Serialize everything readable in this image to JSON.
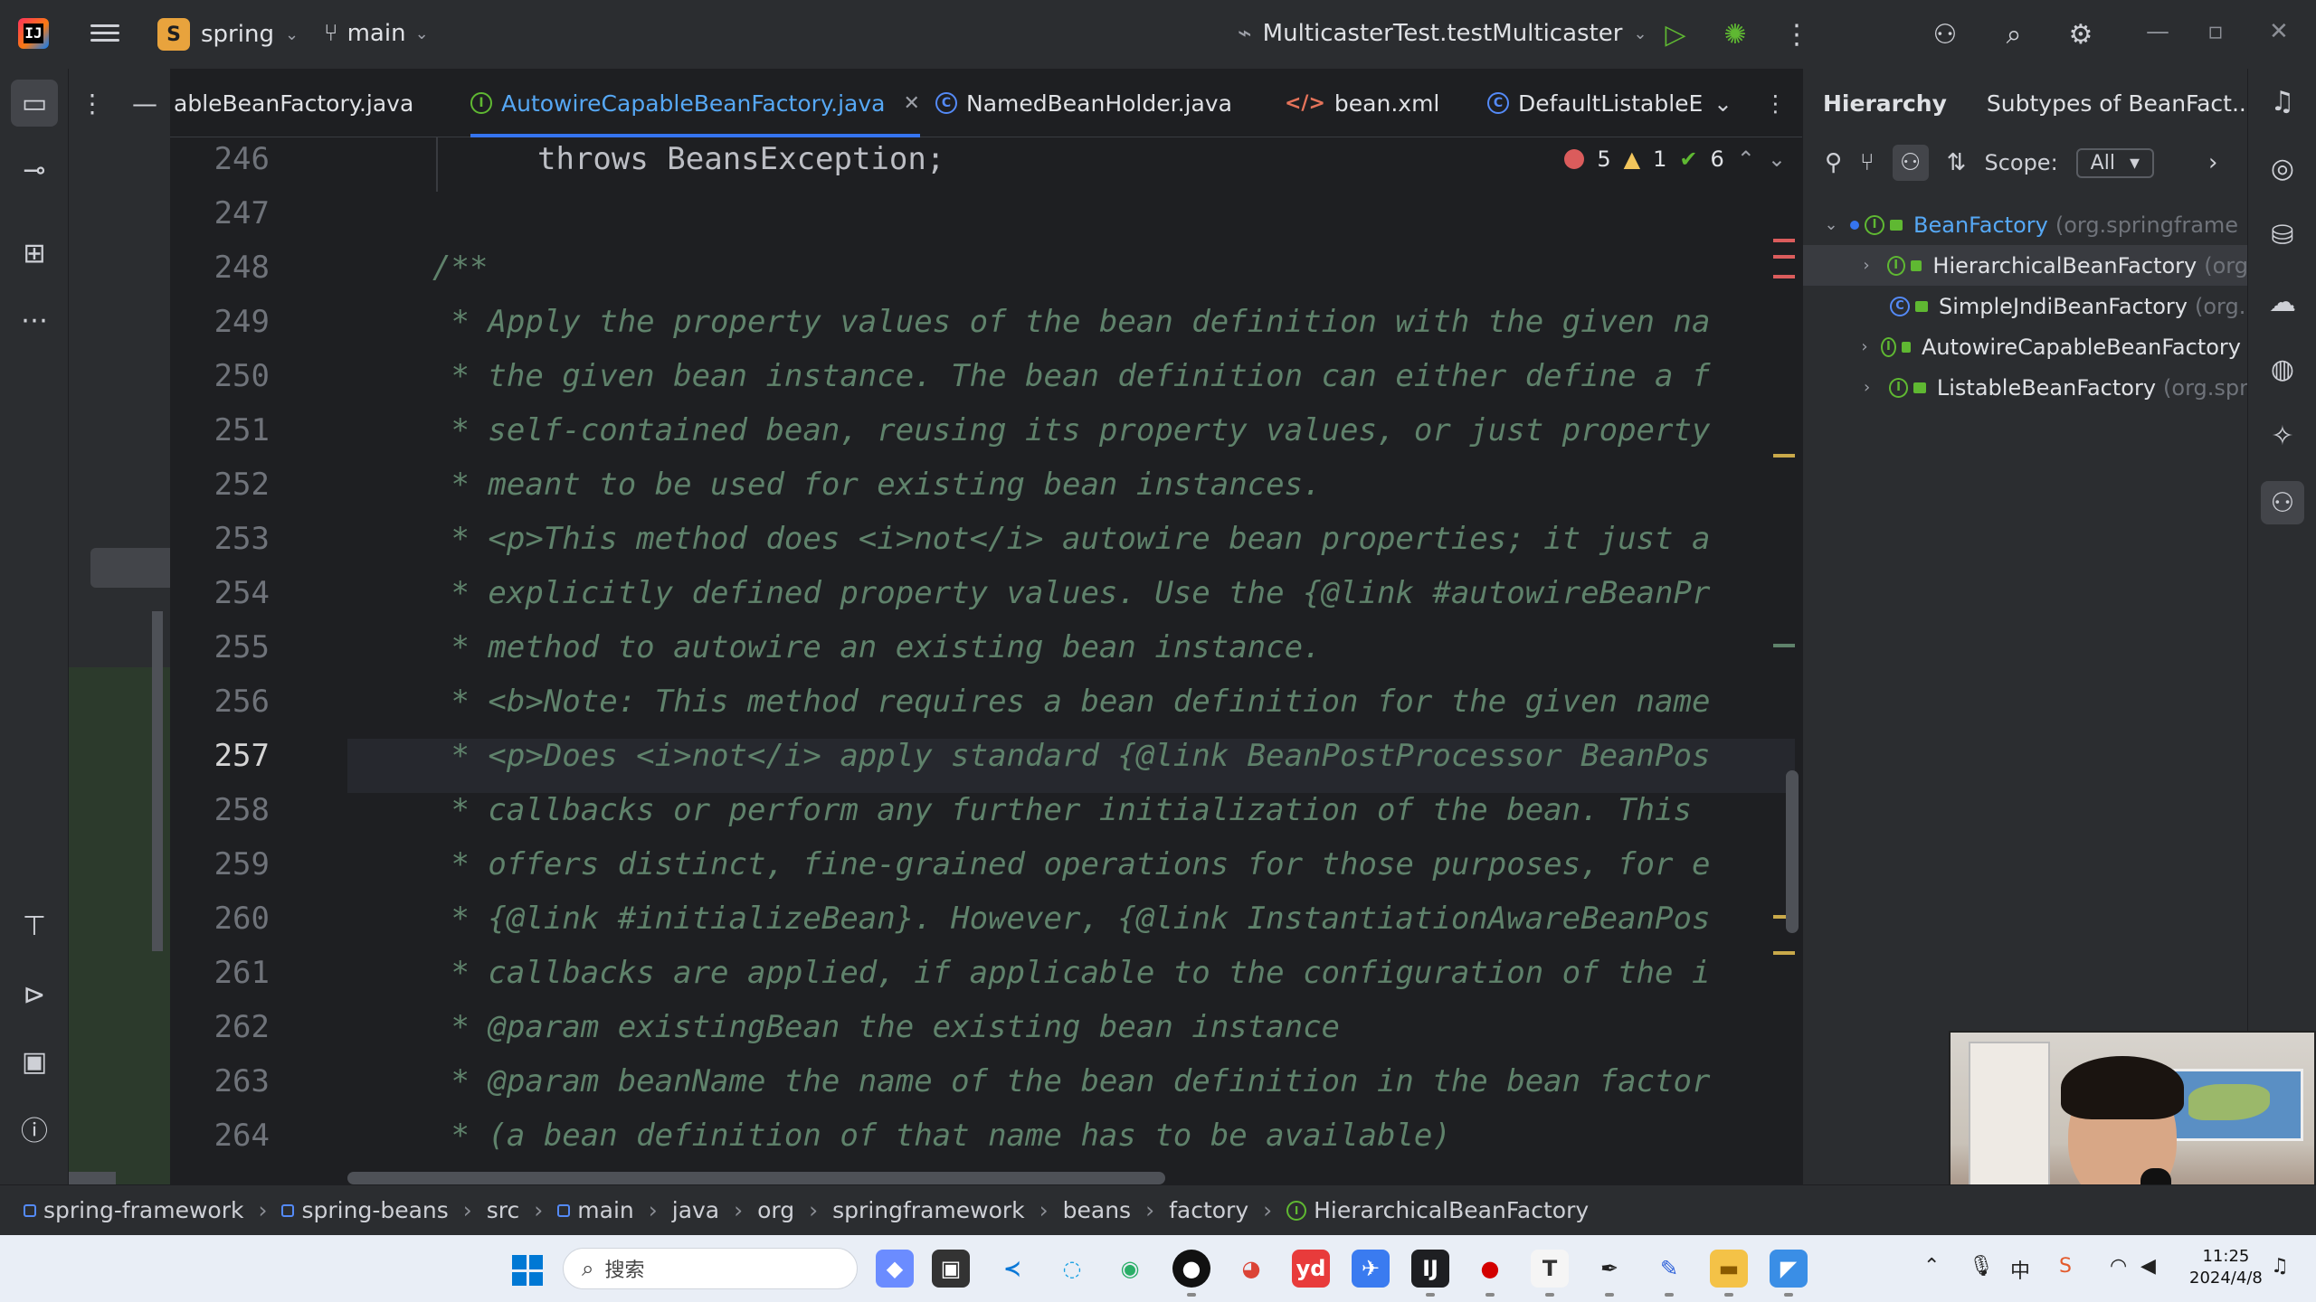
{
  "titlebar": {
    "project_badge": "S",
    "project_name": "spring",
    "branch": "main",
    "run_config": "MulticasterTest.testMulticaster"
  },
  "tabs": [
    {
      "label": "ableBeanFactory.java",
      "kind": "none",
      "active": false
    },
    {
      "label": "AutowireCapableBeanFactory.java",
      "kind": "interface",
      "active": true
    },
    {
      "label": "NamedBeanHolder.java",
      "kind": "class",
      "active": false
    },
    {
      "label": "bean.xml",
      "kind": "xml",
      "active": false
    },
    {
      "label": "DefaultListableE",
      "kind": "class",
      "active": false
    }
  ],
  "inspections": {
    "errors": "5",
    "warnings": "1",
    "weak_warnings": "6"
  },
  "editor": {
    "current_line": "257",
    "lines": [
      {
        "n": "246",
        "text": "throws BeansException;"
      },
      {
        "n": "247",
        "text": ""
      },
      {
        "n": "248",
        "text": "/**"
      },
      {
        "n": "249",
        "text": " * Apply the property values of the bean definition with the given na"
      },
      {
        "n": "250",
        "text": " * the given bean instance. The bean definition can either define a f"
      },
      {
        "n": "251",
        "text": " * self-contained bean, reusing its property values, or just property"
      },
      {
        "n": "252",
        "text": " * meant to be used for existing bean instances."
      },
      {
        "n": "253",
        "text": " * <p>This method does <i>not</i> autowire bean properties; it just a"
      },
      {
        "n": "254",
        "text": " * explicitly defined property values. Use the {@link #autowireBeanPr"
      },
      {
        "n": "255",
        "text": " * method to autowire an existing bean instance."
      },
      {
        "n": "256",
        "text": " * <b>Note: This method requires a bean definition for the given name"
      },
      {
        "n": "257",
        "text": " * <p>Does <i>not</i> apply standard {@link BeanPostProcessor BeanPos"
      },
      {
        "n": "258",
        "text": " * callbacks or perform any further initialization of the bean. This"
      },
      {
        "n": "259",
        "text": " * offers distinct, fine-grained operations for those purposes, for e"
      },
      {
        "n": "260",
        "text": " * {@link #initializeBean}. However, {@link InstantiationAwareBeanPos"
      },
      {
        "n": "261",
        "text": " * callbacks are applied, if applicable to the configuration of the i"
      },
      {
        "n": "262",
        "text": " * @param existingBean the existing bean instance"
      },
      {
        "n": "263",
        "text": " * @param beanName the name of the bean definition in the bean factor"
      },
      {
        "n": "264",
        "text": " * (a bean definition of that name has to be available)"
      }
    ]
  },
  "hierarchy": {
    "tab_hierarchy": "Hierarchy",
    "tab_subtypes": "Subtypes of BeanFact...",
    "scope_label": "Scope:",
    "scope_value": "All",
    "nodes": [
      {
        "name": "BeanFactory",
        "pkg": "(org.springframe",
        "kind": "interface",
        "level": 0,
        "expanded": true
      },
      {
        "name": "HierarchicalBeanFactory",
        "pkg": "(org",
        "kind": "interface",
        "level": 1,
        "expanded": false
      },
      {
        "name": "SimpleJndiBeanFactory",
        "pkg": "(org.",
        "kind": "class",
        "level": 1,
        "expanded": null
      },
      {
        "name": "AutowireCapableBeanFactory",
        "pkg": "",
        "kind": "interface",
        "level": 1,
        "expanded": false
      },
      {
        "name": "ListableBeanFactory",
        "pkg": "(org.spr",
        "kind": "interface",
        "level": 1,
        "expanded": false
      }
    ]
  },
  "breadcrumbs": [
    "spring-framework",
    "spring-beans",
    "src",
    "main",
    "java",
    "org",
    "springframework",
    "beans",
    "factory",
    "HierarchicalBeanFactory"
  ],
  "taskbar": {
    "search_placeholder": "搜索",
    "time": "11:25",
    "date": "2024/4/8"
  },
  "colors": {
    "accent": "#3574f0",
    "comment": "#5f826b",
    "keyword": "#cf8e6d",
    "tag": "#d5b778"
  }
}
